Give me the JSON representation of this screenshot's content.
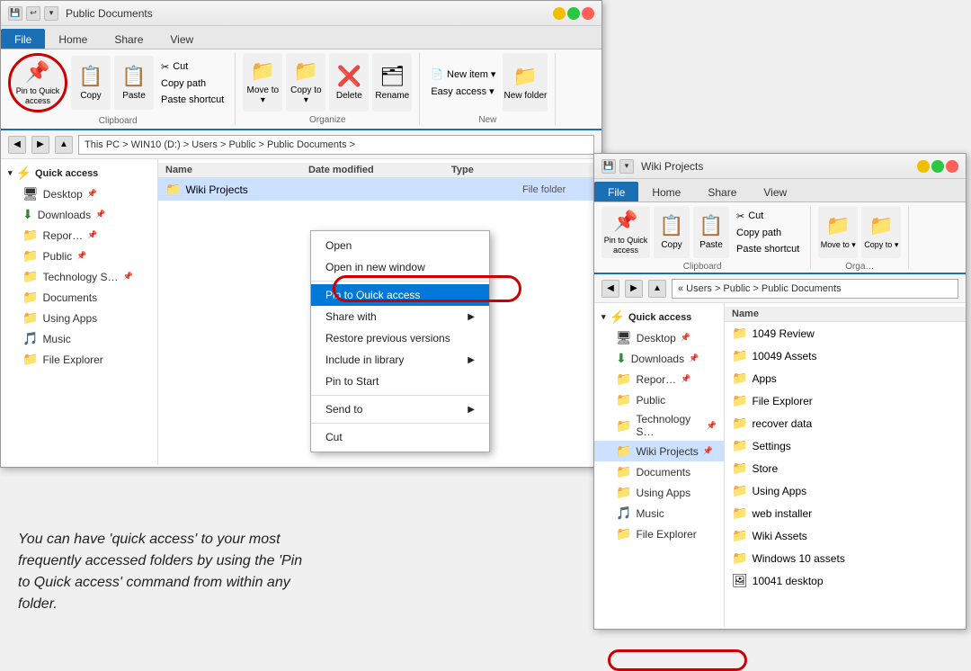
{
  "mainWindow": {
    "title": "Public Documents",
    "tabs": [
      "File",
      "Home",
      "Share",
      "View"
    ],
    "activeTab": "Home",
    "ribbon": {
      "groups": [
        {
          "label": "Clipboard",
          "buttons": [
            {
              "id": "pin-quick-access",
              "label": "Pin to Quick\naccess",
              "icon": "📌",
              "highlighted": true
            },
            {
              "id": "copy",
              "label": "Copy",
              "icon": "📋"
            },
            {
              "id": "paste",
              "label": "Paste",
              "icon": "📋"
            }
          ],
          "smallButtons": [
            {
              "id": "cut",
              "label": "Cut",
              "icon": "✂"
            },
            {
              "id": "copy-path",
              "label": "Copy path"
            },
            {
              "id": "paste-shortcut",
              "label": "Paste shortcut"
            }
          ]
        },
        {
          "label": "Organize",
          "buttons": [
            {
              "id": "move-to",
              "label": "Move\nto ▾",
              "icon": "📁"
            },
            {
              "id": "copy-to",
              "label": "Copy\nto ▾",
              "icon": "📁"
            },
            {
              "id": "delete",
              "label": "Delete",
              "icon": "❌"
            },
            {
              "id": "rename",
              "label": "Rename",
              "icon": "🗂"
            }
          ]
        },
        {
          "label": "New",
          "buttons": [
            {
              "id": "new-item",
              "label": "New item ▾",
              "icon": "📄"
            },
            {
              "id": "easy-access",
              "label": "Easy access ▾"
            },
            {
              "id": "new-folder",
              "label": "New\nfolder",
              "icon": "📁"
            }
          ]
        }
      ]
    },
    "addressBar": "This PC > WIN10 (D:) > Users > Public > Public Documents >",
    "sidebar": {
      "sections": [
        {
          "label": "Quick access",
          "items": [
            {
              "name": "Desktop",
              "pinned": true,
              "icon": "🖥"
            },
            {
              "name": "Downloads",
              "pinned": true,
              "icon": "⬇"
            },
            {
              "name": "Reports",
              "pinned": true,
              "icon": "📁"
            },
            {
              "name": "Public",
              "pinned": true,
              "icon": "📁"
            },
            {
              "name": "Technology S…",
              "pinned": true,
              "icon": "📁"
            },
            {
              "name": "Documents",
              "icon": "📁"
            },
            {
              "name": "Using Apps",
              "icon": "📁"
            },
            {
              "name": "Music",
              "icon": "🎵"
            },
            {
              "name": "File Explorer",
              "icon": "📁"
            }
          ]
        }
      ]
    },
    "fileList": {
      "columns": [
        "Name",
        "Date modified",
        "Type"
      ],
      "items": [
        {
          "name": "Wiki Projects",
          "date": "",
          "type": "File folder",
          "selected": true
        }
      ]
    },
    "contextMenu": {
      "items": [
        {
          "label": "Open",
          "hasArrow": false
        },
        {
          "label": "Open in new window",
          "hasArrow": false
        },
        {
          "separator": true
        },
        {
          "label": "Pin to Quick access",
          "hasArrow": false,
          "highlighted": true
        },
        {
          "label": "Share with",
          "hasArrow": true
        },
        {
          "label": "Restore previous versions",
          "hasArrow": false
        },
        {
          "label": "Include in library",
          "hasArrow": true
        },
        {
          "label": "Pin to Start",
          "hasArrow": false
        },
        {
          "separator": true
        },
        {
          "label": "Send to",
          "hasArrow": true
        },
        {
          "separator": true
        },
        {
          "label": "Cut",
          "hasArrow": false
        }
      ]
    }
  },
  "secondWindow": {
    "title": "Wiki Projects",
    "tabs": [
      "File",
      "Home",
      "Share",
      "View"
    ],
    "activeTab": "Home",
    "addressBar": "« Users > Public > Public Documents",
    "sidebar": {
      "items": [
        {
          "name": "Quick access",
          "isHeader": true
        },
        {
          "name": "Desktop",
          "pinned": true,
          "icon": "🖥"
        },
        {
          "name": "Downloads",
          "pinned": true,
          "icon": "⬇"
        },
        {
          "name": "Reports",
          "pinned": true,
          "icon": "📁"
        },
        {
          "name": "Public",
          "icon": "📁"
        },
        {
          "name": "Technology S…",
          "pinned": true,
          "icon": "📁"
        },
        {
          "name": "Wiki Projects",
          "pinned": true,
          "icon": "📁",
          "highlighted": true
        },
        {
          "name": "Documents",
          "icon": "📁"
        },
        {
          "name": "Using Apps",
          "icon": "📁"
        },
        {
          "name": "Music",
          "icon": "🎵"
        },
        {
          "name": "File Explorer",
          "icon": "📁"
        }
      ]
    },
    "fileList": {
      "columns": [
        "Name"
      ],
      "items": [
        {
          "name": "1049 Review"
        },
        {
          "name": "10049 Assets"
        },
        {
          "name": "Apps"
        },
        {
          "name": "File Explorer"
        },
        {
          "name": "recover data"
        },
        {
          "name": "Settings"
        },
        {
          "name": "Store"
        },
        {
          "name": "Using Apps"
        },
        {
          "name": "web installer"
        },
        {
          "name": "Wiki Assets"
        },
        {
          "name": "Windows 10 assets"
        },
        {
          "name": "10041 desktop"
        }
      ]
    }
  },
  "explanation": {
    "text": "You can have 'quick access' to your most frequently accessed folders by using the 'Pin to Quick access' command from within any folder."
  }
}
